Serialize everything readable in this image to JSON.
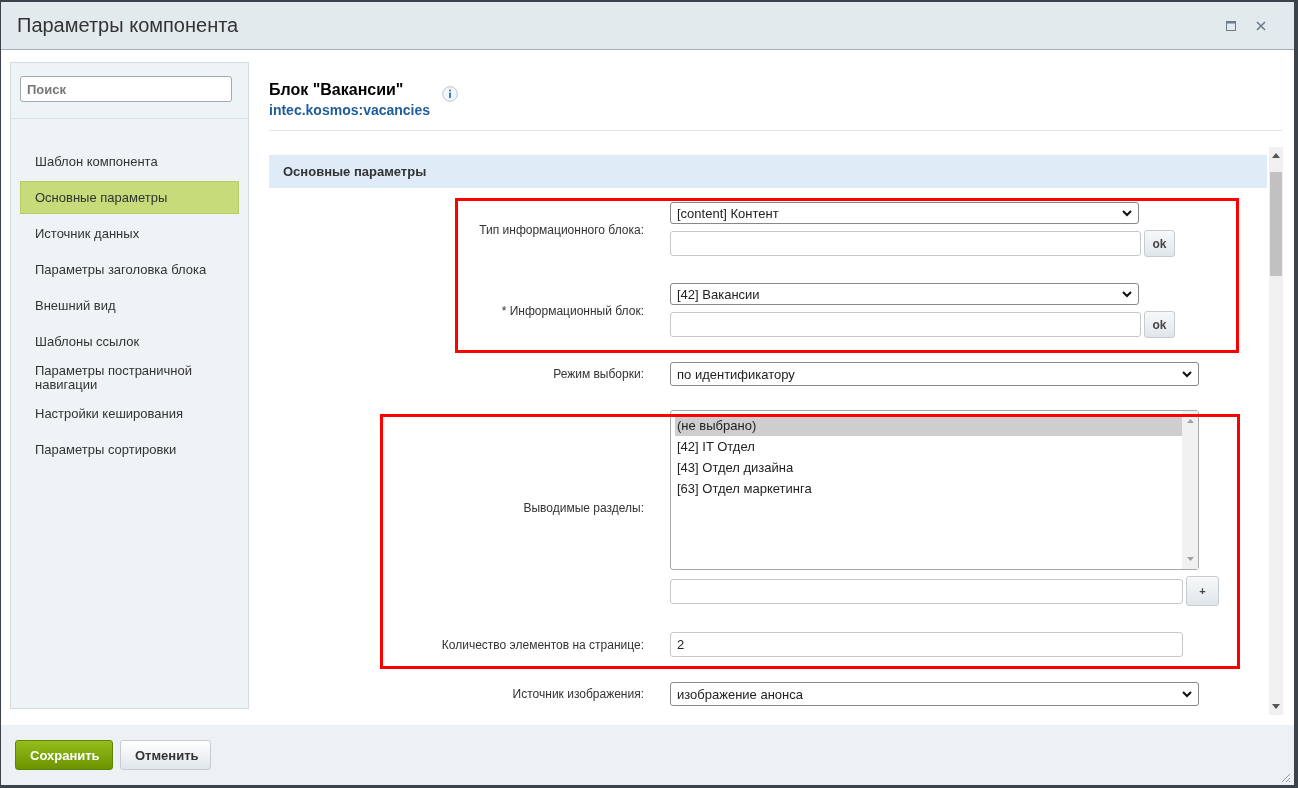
{
  "window": {
    "title": "Параметры компонента"
  },
  "sidebar": {
    "search": {
      "placeholder": "Поиск"
    },
    "items": [
      {
        "label": "Шаблон компонента",
        "selected": false
      },
      {
        "label": "Основные параметры",
        "selected": true
      },
      {
        "label": "Источник данных",
        "selected": false
      },
      {
        "label": "Параметры заголовка блока",
        "selected": false
      },
      {
        "label": "Внешний вид",
        "selected": false
      },
      {
        "label": "Шаблоны ссылок",
        "selected": false
      },
      {
        "label": "Параметры постраничной навигации",
        "selected": false
      },
      {
        "label": "Настройки кеширования",
        "selected": false
      },
      {
        "label": "Параметры сортировки",
        "selected": false
      }
    ]
  },
  "component": {
    "title": "Блок \"Вакансии\"",
    "code": "intec.kosmos:vacancies"
  },
  "section": {
    "title": "Основные параметры"
  },
  "groups": [
    {
      "highlighted": true,
      "fields": [
        {
          "kind": "select_ok",
          "label": "Тип информационного блока:",
          "value": "[content] Контент",
          "button": "ok"
        },
        {
          "kind": "select_ok",
          "label": "* Информационный блок:",
          "value": "[42] Вакансии",
          "button": "ok"
        }
      ]
    },
    {
      "highlighted": false,
      "fields": [
        {
          "kind": "select",
          "label": "Режим выборки:",
          "value": "по идентификатору"
        }
      ]
    },
    {
      "highlighted": true,
      "fields": [
        {
          "kind": "listbox_add",
          "label": "Выводимые разделы:",
          "button": "+",
          "options": [
            {
              "label": "(не выбрано)",
              "selected": true
            },
            {
              "label": "[42] IT Отдел",
              "selected": false
            },
            {
              "label": "[43] Отдел дизайна",
              "selected": false
            },
            {
              "label": "[63] Отдел маркетинга",
              "selected": false
            }
          ]
        },
        {
          "kind": "text",
          "label": "Количество элементов на странице:",
          "value": "2"
        }
      ]
    },
    {
      "highlighted": false,
      "fields": [
        {
          "kind": "select",
          "label": "Источник изображения:",
          "value": "изображение анонса"
        }
      ]
    }
  ],
  "buttons": [
    {
      "label": "Сохранить",
      "kind": "primary"
    },
    {
      "label": "Отменить",
      "kind": "secondary"
    }
  ]
}
